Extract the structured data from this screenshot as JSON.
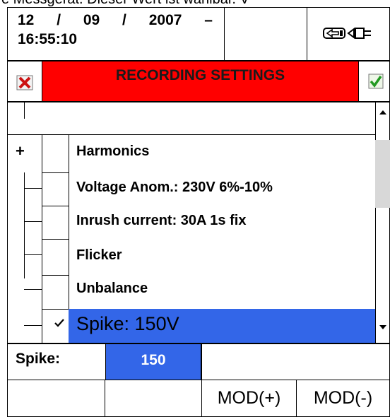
{
  "top_clipped_text": "e Messgerät. Dieser Wert ist wählbar. V",
  "header": {
    "date": "12 / 09 / 2007 –",
    "time": "16:55:10",
    "status_icon": "power-connector-icon"
  },
  "title_bar": {
    "title": "RECORDING SETTINGS",
    "cancel_icon": "cancel-x-icon",
    "confirm_icon": "confirm-check-icon",
    "background_color": "#ff0000"
  },
  "tree": {
    "expand_symbol": "+",
    "items": [
      {
        "label": "Harmonics",
        "checked": false
      },
      {
        "label": "Voltage Anom.: 230V 6%-10%",
        "checked": false
      },
      {
        "label": "Inrush current: 30A 1s fix",
        "checked": false
      },
      {
        "label": "Flicker",
        "checked": false
      },
      {
        "label": "Unbalance",
        "checked": false
      },
      {
        "label": "Spike: 150V",
        "checked": true,
        "selected": true
      }
    ],
    "selection_color": "#3366e8"
  },
  "parameter": {
    "label": "Spike:",
    "value": "150"
  },
  "function_keys": [
    "",
    "",
    "MOD(+)",
    "MOD(-)"
  ]
}
